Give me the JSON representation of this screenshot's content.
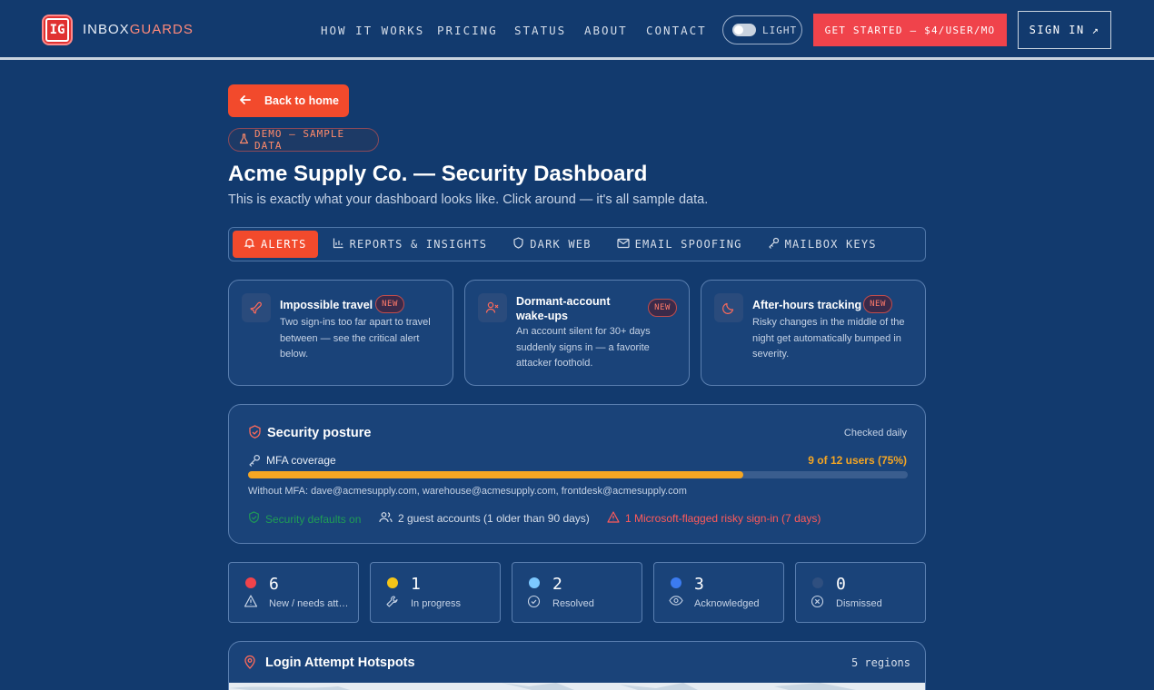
{
  "header": {
    "logo_text": "IG",
    "brand_part1": "INBOX",
    "brand_part2": "GUARDS",
    "nav": [
      "HOW IT WORKS",
      "PRICING",
      "STATUS",
      "ABOUT",
      "CONTACT"
    ],
    "theme_toggle_label": "LIGHT",
    "cta_label": "GET STARTED — $4/USER/MO",
    "signin_label": "SIGN IN",
    "signin_icon": "↗"
  },
  "page": {
    "back_label": "Back to home",
    "demo_badge": "DEMO — SAMPLE DATA",
    "title": "Acme Supply Co. — Security Dashboard",
    "subtitle": "This is exactly what your dashboard looks like. Click around — it's all sample data."
  },
  "tabs": [
    {
      "label": "ALERTS",
      "icon": "bell-icon",
      "active": true
    },
    {
      "label": "REPORTS & INSIGHTS",
      "icon": "bar-chart-icon",
      "active": false
    },
    {
      "label": "DARK WEB",
      "icon": "shield-icon",
      "active": false
    },
    {
      "label": "EMAIL SPOOFING",
      "icon": "mail-icon",
      "active": false
    },
    {
      "label": "MAILBOX KEYS",
      "icon": "key-icon",
      "active": false
    }
  ],
  "features": [
    {
      "title": "Impossible travel",
      "badge": "NEW",
      "description": "Two sign-ins too far apart to travel between — see the critical alert below.",
      "icon": "plane-icon"
    },
    {
      "title": "Dormant-account wake-ups",
      "badge": "NEW",
      "description": "An account silent for 30+ days suddenly signs in — a favorite attacker foothold.",
      "icon": "user-x-icon"
    },
    {
      "title": "After-hours tracking",
      "badge": "NEW",
      "description": "Risky changes in the middle of the night get automatically bumped in severity.",
      "icon": "moon-icon"
    }
  ],
  "posture": {
    "title": "Security posture",
    "checked": "Checked daily",
    "mfa_label": "MFA coverage",
    "mfa_value": "9 of 12 users (75%)",
    "mfa_fraction": 0.75,
    "without_mfa": "Without MFA: dave@acmesupply.com, warehouse@acmesupply.com, frontdesk@acmesupply.com",
    "security_defaults": "Security defaults on",
    "guest_accounts": "2 guest accounts (1 older than 90 days)",
    "risky_signin": "1 Microsoft-flagged risky sign-in (7 days)"
  },
  "counters": [
    {
      "count": "6",
      "label": "New / needs attention",
      "dot_color": "#f0434b",
      "icon": "warning-icon"
    },
    {
      "count": "1",
      "label": "In progress",
      "dot_color": "#f5c518",
      "icon": "wrench-icon"
    },
    {
      "count": "2",
      "label": "Resolved",
      "dot_color": "#7cc8ff",
      "icon": "check-circle-icon"
    },
    {
      "count": "3",
      "label": "Acknowledged",
      "dot_color": "#3b7bf0",
      "icon": "eye-icon"
    },
    {
      "count": "0",
      "label": "Dismissed",
      "dot_color": "#2f4f7f",
      "icon": "x-circle-icon"
    }
  ],
  "hotspots": {
    "title": "Login Attempt Hotspots",
    "count": "5 regions"
  },
  "colors": {
    "background": "#123a6e",
    "accent": "#f24a2c",
    "warning": "#f5a623",
    "danger": "#ff5a5a",
    "success": "#1f9d55"
  }
}
